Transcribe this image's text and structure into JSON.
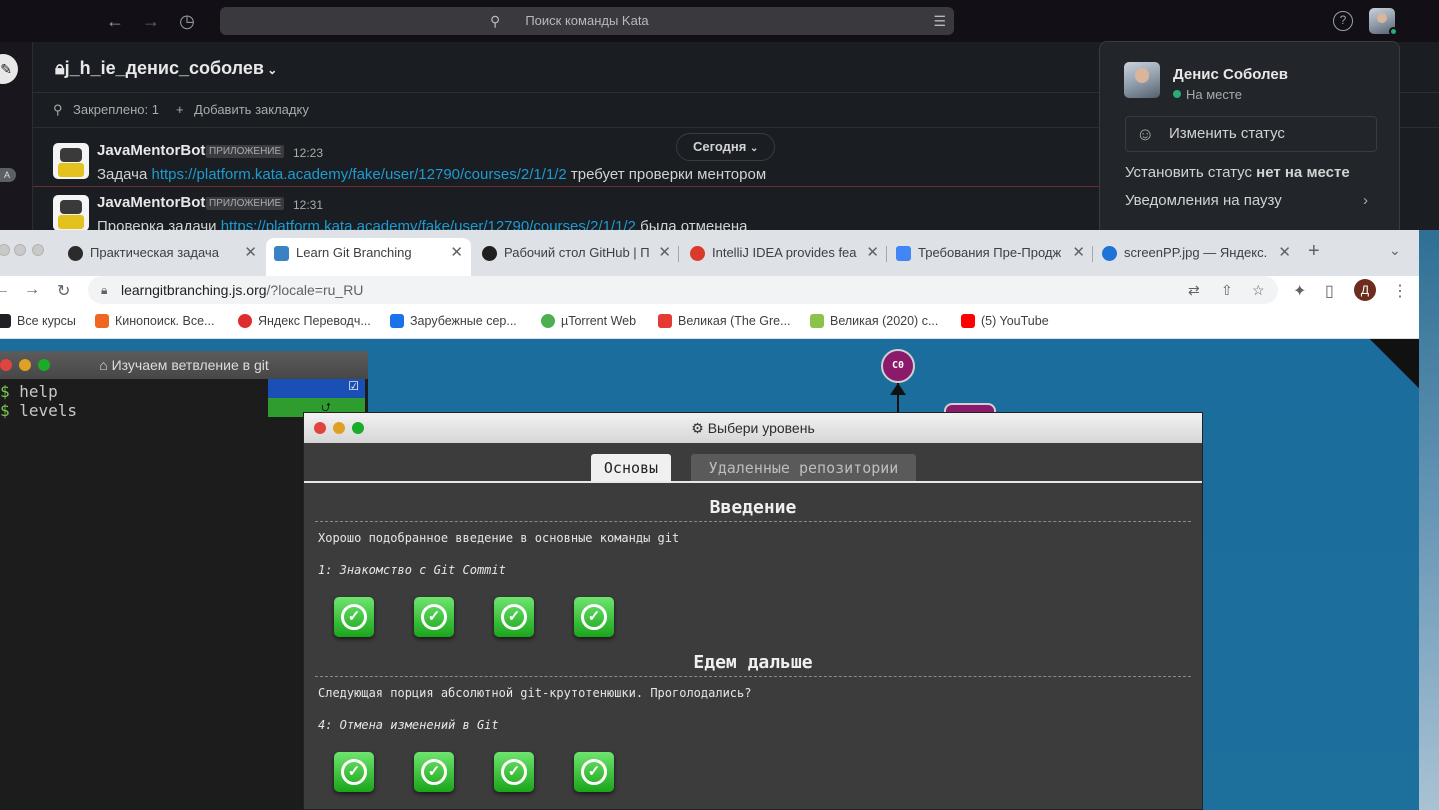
{
  "slack": {
    "search_placeholder": "Поиск команды Kata",
    "channel_title": "j_h_ie_денис_соболев",
    "pinned": "Закреплено: 1",
    "add_bookmark": "Добавить закладку",
    "today": "Сегодня",
    "side_badge": "A",
    "messages": [
      {
        "name": "JavaMentorBot",
        "tag": "ПРИЛОЖЕНИЕ",
        "time": "12:23",
        "pre": "Задача ",
        "link": "https://platform.kata.academy/fake/user/12790/courses/2/1/1/2",
        "post": " требует проверки ментором"
      },
      {
        "name": "JavaMentorBot",
        "tag": "ПРИЛОЖЕНИЕ",
        "time": "12:31",
        "pre": "Проверка задачи ",
        "link": "https://platform.kata.academy/fake/user/12790/courses/2/1/1/2",
        "post": " была отменена"
      }
    ],
    "profile": {
      "name": "Денис Соболев",
      "status": "На месте",
      "change_status": "Изменить статус",
      "set_away_pre": "Установить статус ",
      "set_away_bold": "нет на месте",
      "pause": "Уведомления на паузу"
    }
  },
  "chrome": {
    "tabs": [
      {
        "title": "Практическая задача",
        "color": "#2b2b2b"
      },
      {
        "title": "Learn Git Branching",
        "color": "#3b82c4"
      },
      {
        "title": "Рабочий стол GitHub | П",
        "color": "#1f1f1f"
      },
      {
        "title": "IntelliJ IDEA provides fea",
        "color": "#d93a2b"
      },
      {
        "title": "Требования Пре-Продж",
        "color": "#4285f4"
      },
      {
        "title": "screenPP.jpg — Яндекс.",
        "color": "#1e73d8"
      }
    ],
    "url_host": "learngitbranching.js.org",
    "url_rest": "/?locale=ru_RU",
    "profile_letter": "Д",
    "bookmarks": [
      {
        "label": "Все курсы",
        "color": "#202124"
      },
      {
        "label": "Кинопоиск. Все...",
        "color": "#f16522"
      },
      {
        "label": "Яндекс Переводч...",
        "color": "#e02c2c"
      },
      {
        "label": "Зарубежные сер...",
        "color": "#1a73e8"
      },
      {
        "label": "µTorrent Web",
        "color": "#4caf50"
      },
      {
        "label": "Великая (The Gre...",
        "color": "#e53935"
      },
      {
        "label": "Великая (2020) с...",
        "color": "#8bc34a"
      },
      {
        "label": "(5) YouTube",
        "color": "#ff0000"
      }
    ]
  },
  "terminal": {
    "title": "Изучаем ветвление в git",
    "lines": [
      "help",
      "levels"
    ]
  },
  "graph": {
    "commit_label": "C0"
  },
  "dialog": {
    "title": "Выбери уровень",
    "tab_basics": "Основы",
    "tab_remote": "Удаленные репозитории",
    "sections": [
      {
        "title": "Введение",
        "desc": "Хорошо подобранное введение в основные команды git",
        "level": "1: Знакомство с Git Commit"
      },
      {
        "title": "Едем дальше",
        "desc": "Следующая порция абсолютной git-крутотенюшки. Проголодались?",
        "level": "4: Отмена изменений в Git"
      }
    ]
  }
}
